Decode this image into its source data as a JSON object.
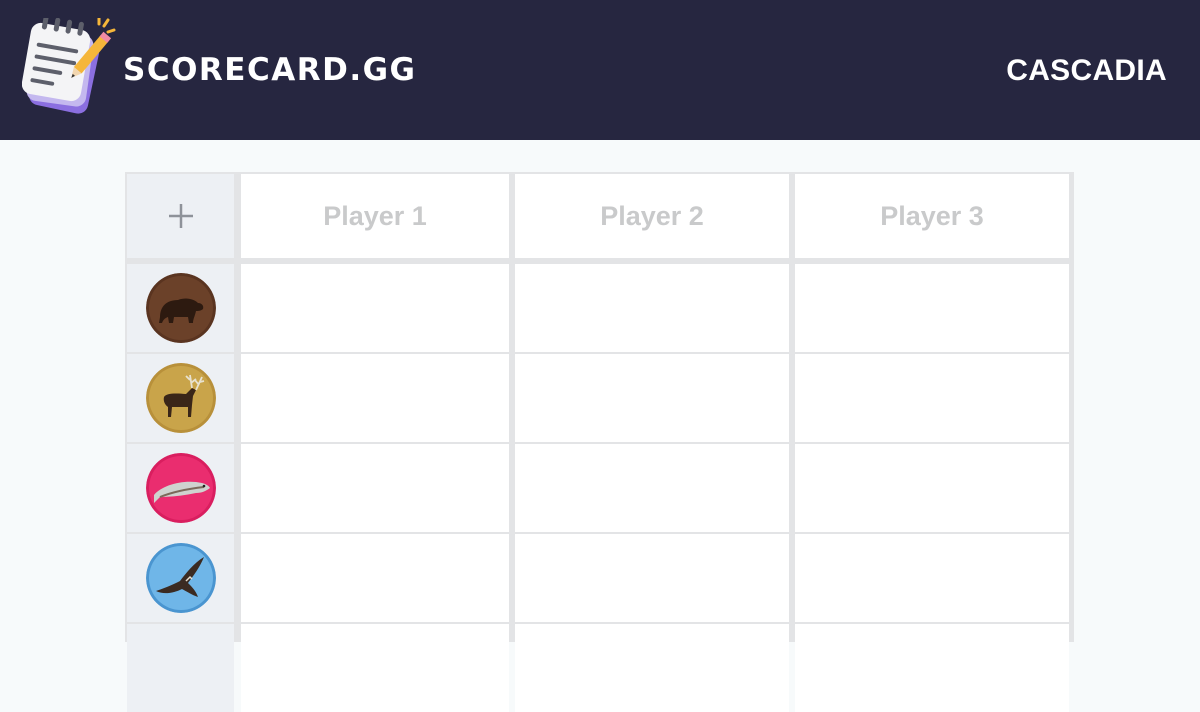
{
  "header": {
    "brand": "SCORECARD.GG",
    "game": "CASCADIA",
    "logo_icon": "notepad-pencil-icon"
  },
  "table": {
    "add_icon": "+",
    "players": [
      "Player 1",
      "Player 2",
      "Player 3"
    ],
    "rows": [
      {
        "wildlife": "bear",
        "icon": "bear-token-icon",
        "color": "#5a3420"
      },
      {
        "wildlife": "elk",
        "icon": "elk-token-icon",
        "color": "#c9a44a"
      },
      {
        "wildlife": "salmon",
        "icon": "salmon-token-icon",
        "color": "#ea2d6f"
      },
      {
        "wildlife": "hawk",
        "icon": "hawk-token-icon",
        "color": "#5aa7e0"
      }
    ]
  },
  "colors": {
    "header_bg": "#262640",
    "page_bg": "#f7fafb",
    "grid_lines": "#e3e4e6",
    "side_column": "#edf0f4",
    "player_label": "#c9cacb"
  }
}
